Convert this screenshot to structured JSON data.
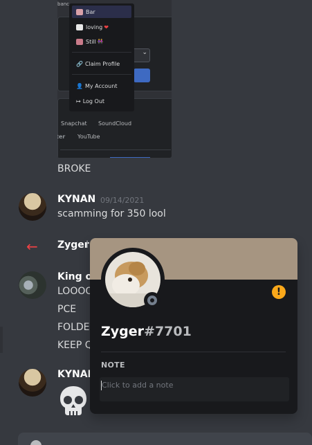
{
  "embed": {
    "cut_text": "banc",
    "select_chevron": "⌄",
    "socials": [
      "Snapchat",
      "SoundCloud",
      "ter",
      "YouTube"
    ]
  },
  "dropdown": {
    "items": [
      {
        "label": "Bar",
        "icon": "pink-avatar-icon"
      },
      {
        "label": "loving",
        "suffix": "❤",
        "icon": "bow-avatar-icon"
      },
      {
        "label": "Still",
        "suffix": "👭",
        "icon": "pink-avatar-icon"
      },
      {
        "label": "Claim Profile",
        "icon": "link-icon"
      },
      {
        "label": "My Account",
        "icon": "user-icon"
      },
      {
        "label": "Log Out",
        "icon": "logout-icon"
      }
    ]
  },
  "messages": {
    "broke_text": "BROKE",
    "kynan1": {
      "username": "KYNAN",
      "timestamp": "09/14/2021",
      "text": "scamming for 350 lool"
    },
    "zyger_join": {
      "username": "Zyger",
      "arrow": "←",
      "trailing": "I"
    },
    "king": {
      "username": "King of",
      "lines": [
        "LOOOO",
        "PCE",
        "FOLDE",
        "KEEP Q"
      ]
    },
    "kynan2": {
      "username": "KYNAN"
    }
  },
  "popout": {
    "username": "Zyger",
    "discriminator": "#7701",
    "badge": "!",
    "note_label": "NOTE",
    "note_placeholder": "Click to add a note",
    "banner_color": "#a69581",
    "status": "offline"
  },
  "colors": {
    "background": "#36393f",
    "popout_bg": "#18191c",
    "accent_warning": "#faa81a",
    "arrow_red": "#ed4245"
  }
}
